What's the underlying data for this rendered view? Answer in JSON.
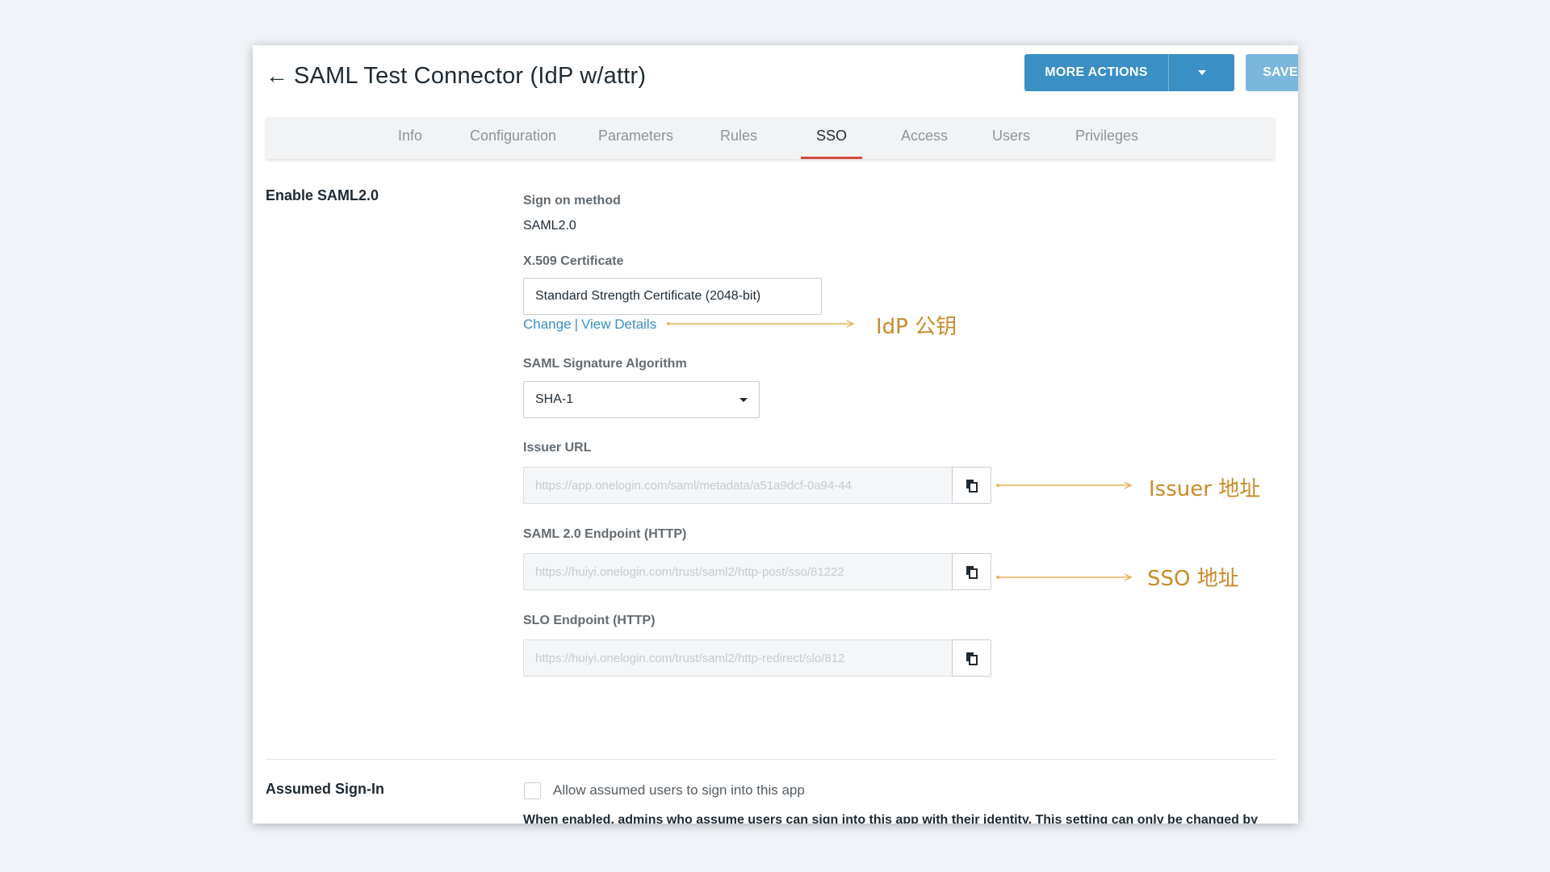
{
  "header": {
    "back_icon": "left-arrow-icon",
    "title": "SAML Test Connector (IdP w/attr)",
    "more_actions_label": "MORE ACTIONS",
    "save_label": "SAVE"
  },
  "tabs": [
    {
      "label": "Info",
      "active": false
    },
    {
      "label": "Configuration",
      "active": false
    },
    {
      "label": "Parameters",
      "active": false
    },
    {
      "label": "Rules",
      "active": false
    },
    {
      "label": "SSO",
      "active": true
    },
    {
      "label": "Access",
      "active": false
    },
    {
      "label": "Users",
      "active": false
    },
    {
      "label": "Privileges",
      "active": false
    }
  ],
  "sso": {
    "section_title": "Enable SAML2.0",
    "sign_on_method_label": "Sign on method",
    "sign_on_method_value": "SAML2.0",
    "certificate_label": "X.509 Certificate",
    "certificate_value": "Standard Strength Certificate (2048-bit)",
    "change_link": "Change",
    "link_separator": "|",
    "view_details_link": "View Details",
    "signature_algorithm_label": "SAML Signature Algorithm",
    "signature_algorithm_value": "SHA-1",
    "issuer_url_label": "Issuer URL",
    "issuer_url_value": "https://app.onelogin.com/saml/metadata/a51a9dcf-0a94-44",
    "saml_endpoint_label": "SAML 2.0 Endpoint (HTTP)",
    "saml_endpoint_value": "https://huiyi.onelogin.com/trust/saml2/http-post/sso/81222",
    "slo_endpoint_label": "SLO Endpoint (HTTP)",
    "slo_endpoint_value": "https://huiyi.onelogin.com/trust/saml2/http-redirect/slo/812"
  },
  "assumed": {
    "section_title": "Assumed Sign-In",
    "checkbox_label": "Allow assumed users to sign into this app",
    "checked": false,
    "note": "When enabled, admins who assume users can sign into this app with their identity. This setting can only be changed by the account owner. Note that the account owner can also completely disable the assume feature under Account -> Settings."
  },
  "annotations": {
    "idp_key": "IdP 公钥",
    "issuer": "Issuer 地址",
    "sso": "SSO 地址"
  },
  "colors": {
    "primary_button": "#3a8fc5",
    "save_button": "#7bb6dc",
    "active_tab_underline": "#d34b3f",
    "link": "#3a8fc5",
    "annotation": "#c98b2a",
    "page_background": "#f0f4f8"
  },
  "icons": {
    "copy": "copy-icon",
    "dropdown": "caret-down-icon"
  }
}
